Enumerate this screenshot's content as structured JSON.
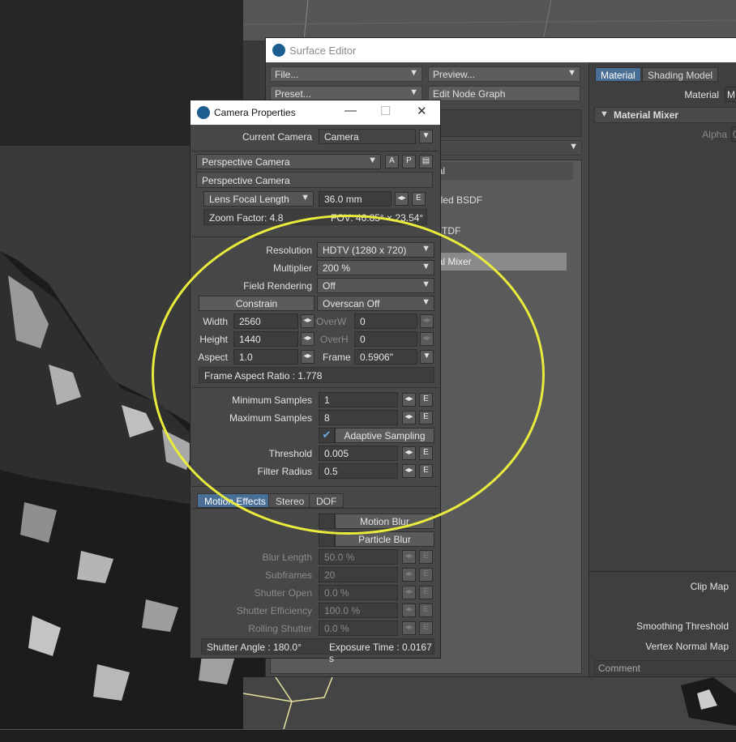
{
  "surface_editor": {
    "title": "Surface Editor",
    "file_label": "File...",
    "preview_label": "Preview...",
    "preset_label": "Preset...",
    "edit_node_graph_label": "Edit Node Graph",
    "list_header_fragment": "ial",
    "list_items": [
      "pled BSDF",
      "BTDF",
      "ial Mixer"
    ],
    "tabs": [
      "Material",
      "Shading Model"
    ],
    "material_label": "Material",
    "material_value": "M",
    "section_title": "Material Mixer",
    "alpha_label": "Alpha",
    "alpha_value": "0",
    "clip_map_label": "Clip Map",
    "smoothing_threshold_label": "Smoothing Threshold",
    "vertex_normal_map_label": "Vertex Normal Map",
    "comment_label": "Comment"
  },
  "camera_properties": {
    "title": "Camera Properties",
    "current_camera_label": "Current Camera",
    "current_camera_value": "Camera",
    "camera_type": "Perspective Camera",
    "btn_a": "A",
    "btn_p": "P",
    "sub_header": "Perspective Camera",
    "lens_mode": "Lens Focal Length",
    "lens_value": "36.0 mm",
    "zoom_factor": "Zoom Factor: 4.8",
    "fov": "FOV: 46.85° × 23.54°",
    "resolution_label": "Resolution",
    "resolution_value": "HDTV (1280 x 720)",
    "multiplier_label": "Multiplier",
    "multiplier_value": "200 %",
    "field_rendering_label": "Field Rendering",
    "field_rendering_value": "Off",
    "constrain_label": "Constrain",
    "overscan_value": "Overscan Off",
    "width_label": "Width",
    "width_value": "2560",
    "overw_label": "OverW",
    "overw_value": "0",
    "height_label": "Height",
    "height_value": "1440",
    "overh_label": "OverH",
    "overh_value": "0",
    "aspect_label": "Aspect",
    "aspect_value": "1.0",
    "frame_label": "Frame",
    "frame_value": "0.5906\"",
    "frame_aspect_ratio": "Frame Aspect Ratio : 1.778",
    "min_samples_label": "Minimum Samples",
    "min_samples_value": "1",
    "max_samples_label": "Maximum Samples",
    "max_samples_value": "8",
    "adaptive_sampling_label": "Adaptive Sampling",
    "threshold_label": "Threshold",
    "threshold_value": "0.005",
    "filter_radius_label": "Filter Radius",
    "filter_radius_value": "0.5",
    "tabs": [
      "Motion Effects",
      "Stereo",
      "DOF"
    ],
    "motion_blur_label": "Motion Blur",
    "particle_blur_label": "Particle Blur",
    "blur_length_label": "Blur Length",
    "blur_length_value": "50.0 %",
    "subframes_label": "Subframes",
    "subframes_value": "20",
    "shutter_open_label": "Shutter Open",
    "shutter_open_value": "0.0 %",
    "shutter_efficiency_label": "Shutter Efficiency",
    "shutter_efficiency_value": "100.0 %",
    "rolling_shutter_label": "Rolling Shutter",
    "rolling_shutter_value": "0.0 %",
    "shutter_angle": "Shutter Angle : 180.0°",
    "exposure_time": "Exposure Time : 0.0167 s",
    "e_label": "E"
  },
  "colors": {
    "highlight_ellipse": "#e9ec3c",
    "active_tab": "#4a6f96",
    "panel_bg": "#474747"
  }
}
